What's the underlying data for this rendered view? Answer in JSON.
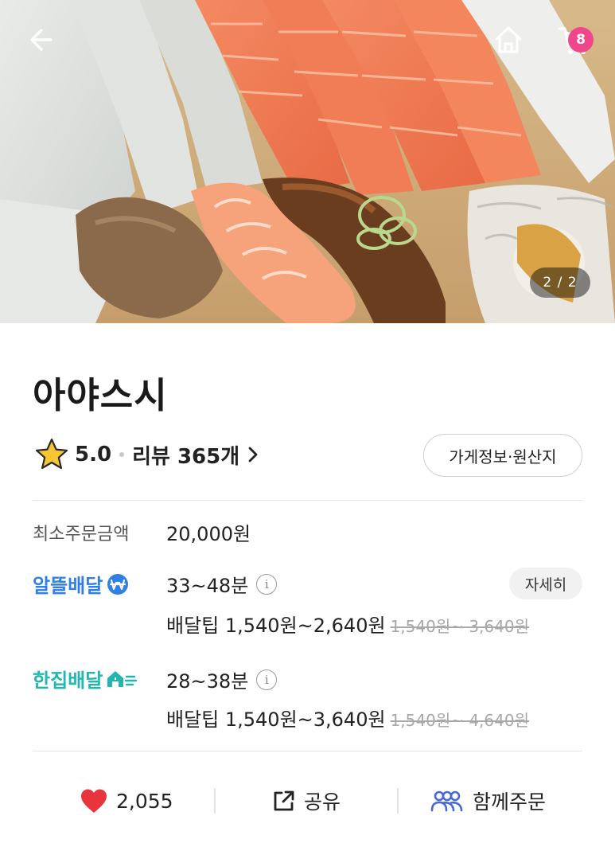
{
  "hero": {
    "page_indicator": "2 / 2",
    "cart_count": "8"
  },
  "store": {
    "name": "아야스시",
    "rating": "5.0",
    "review_label": "리뷰 365개",
    "info_button": "가게정보·원산지"
  },
  "min_order": {
    "label": "최소주문금액",
    "value": "20,000원"
  },
  "deliveries": [
    {
      "label": "알뜰배달",
      "time": "33~48분",
      "tip": "배달팁 1,540원~2,640원",
      "tip_original": "1,540원~ 3,640원",
      "color": "#2f7fe6"
    },
    {
      "label": "한집배달",
      "time": "28~38분",
      "tip": "배달팁 1,540원~3,640원",
      "tip_original": "1,540원~ 4,640원",
      "color": "#1fb7b0"
    }
  ],
  "detail_button": "자세히",
  "actions": {
    "like_count": "2,055",
    "share_label": "공유",
    "group_order_label": "함께주문"
  },
  "colors": {
    "accent_pink": "#f0468c",
    "heart_red": "#e8343c",
    "group_blue": "#4a67d6"
  }
}
